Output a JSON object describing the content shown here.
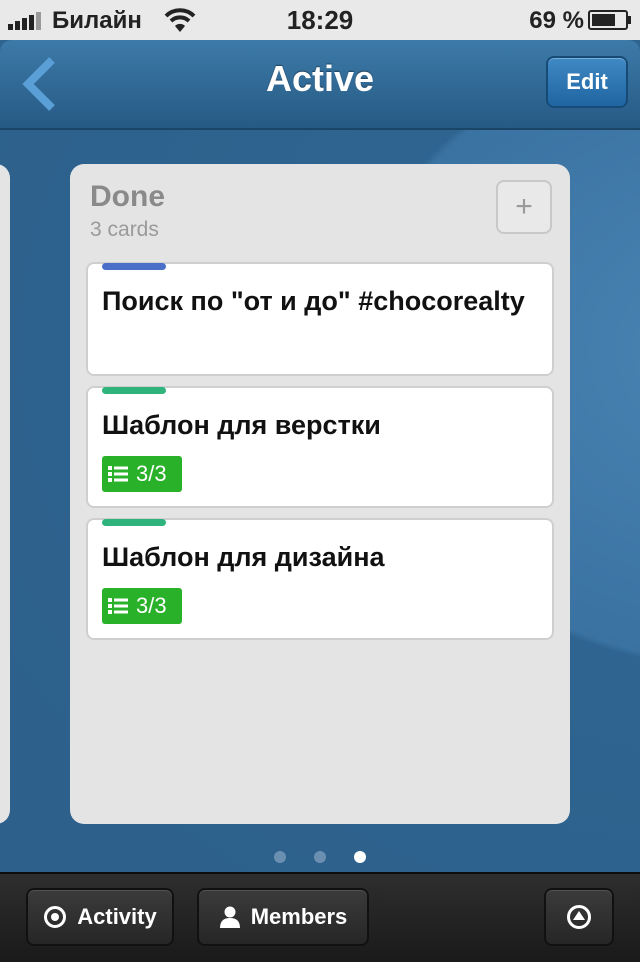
{
  "status_bar": {
    "carrier": "Билайн",
    "time": "18:29",
    "battery": "69 %"
  },
  "nav": {
    "title": "Active",
    "edit_label": "Edit"
  },
  "list": {
    "title": "Done",
    "count": "3 cards",
    "add_symbol": "+",
    "cards": [
      {
        "label_color": "#4a6fc9",
        "title": "Поиск по \"от и до\" #chocorealty"
      },
      {
        "label_color": "#2fb37c",
        "title": "Шаблон для верстки",
        "checklist": "3/3"
      },
      {
        "label_color": "#2fb37c",
        "title": "Шаблон для дизайна",
        "checklist": "3/3"
      }
    ]
  },
  "page_dots": {
    "count": 3,
    "active": 3
  },
  "toolbar": {
    "activity_label": "Activity",
    "members_label": "Members"
  },
  "icons": [
    "signal-icon",
    "wifi-icon",
    "battery-icon",
    "back-chevron-icon",
    "plus-icon",
    "checklist-icon",
    "activity-icon",
    "members-icon",
    "up-arrow-icon"
  ]
}
